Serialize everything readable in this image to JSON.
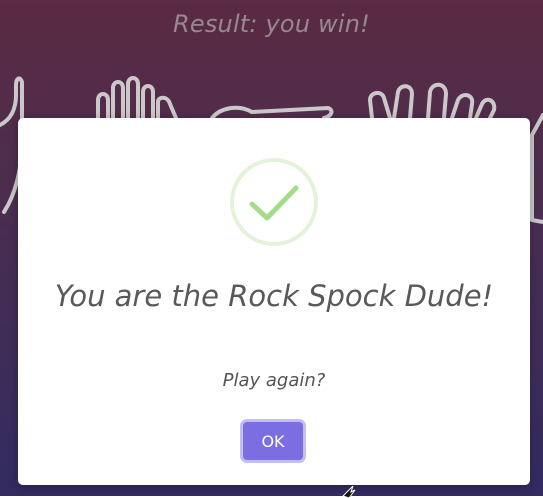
{
  "page": {
    "result_title": "Result: you win!"
  },
  "modal": {
    "title": "You are the Rock Spock Dude!",
    "text": "Play again?",
    "confirm_label": "OK",
    "icon": "success-check-icon"
  },
  "colors": {
    "bg_top": "#6f3452",
    "bg_bottom": "#3e3577",
    "accent": "#7b6ee0",
    "success": "#a5dc86"
  }
}
